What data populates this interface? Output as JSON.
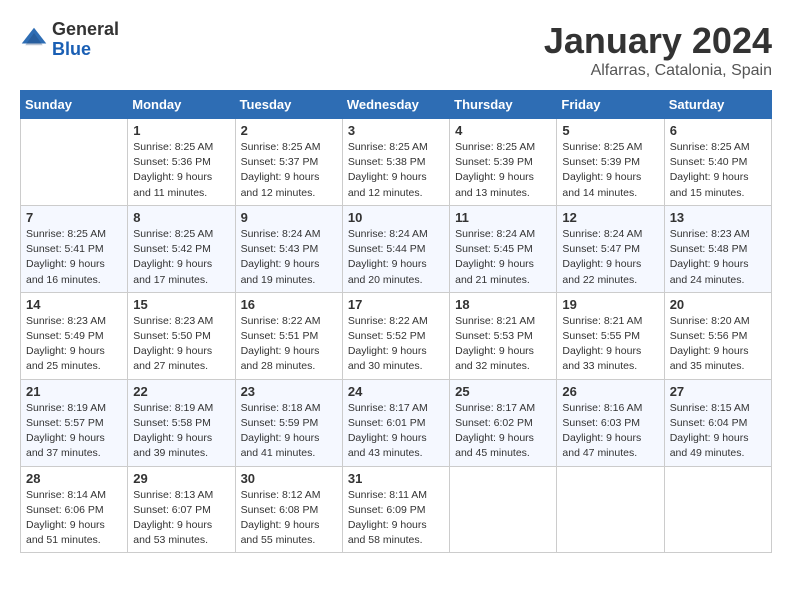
{
  "header": {
    "logo_general": "General",
    "logo_blue": "Blue",
    "month_title": "January 2024",
    "location": "Alfarras, Catalonia, Spain"
  },
  "weekdays": [
    "Sunday",
    "Monday",
    "Tuesday",
    "Wednesday",
    "Thursday",
    "Friday",
    "Saturday"
  ],
  "weeks": [
    [
      {
        "day": "",
        "sunrise": "",
        "sunset": "",
        "daylight": ""
      },
      {
        "day": "1",
        "sunrise": "Sunrise: 8:25 AM",
        "sunset": "Sunset: 5:36 PM",
        "daylight": "Daylight: 9 hours and 11 minutes."
      },
      {
        "day": "2",
        "sunrise": "Sunrise: 8:25 AM",
        "sunset": "Sunset: 5:37 PM",
        "daylight": "Daylight: 9 hours and 12 minutes."
      },
      {
        "day": "3",
        "sunrise": "Sunrise: 8:25 AM",
        "sunset": "Sunset: 5:38 PM",
        "daylight": "Daylight: 9 hours and 12 minutes."
      },
      {
        "day": "4",
        "sunrise": "Sunrise: 8:25 AM",
        "sunset": "Sunset: 5:39 PM",
        "daylight": "Daylight: 9 hours and 13 minutes."
      },
      {
        "day": "5",
        "sunrise": "Sunrise: 8:25 AM",
        "sunset": "Sunset: 5:39 PM",
        "daylight": "Daylight: 9 hours and 14 minutes."
      },
      {
        "day": "6",
        "sunrise": "Sunrise: 8:25 AM",
        "sunset": "Sunset: 5:40 PM",
        "daylight": "Daylight: 9 hours and 15 minutes."
      }
    ],
    [
      {
        "day": "7",
        "sunrise": "Sunrise: 8:25 AM",
        "sunset": "Sunset: 5:41 PM",
        "daylight": "Daylight: 9 hours and 16 minutes."
      },
      {
        "day": "8",
        "sunrise": "Sunrise: 8:25 AM",
        "sunset": "Sunset: 5:42 PM",
        "daylight": "Daylight: 9 hours and 17 minutes."
      },
      {
        "day": "9",
        "sunrise": "Sunrise: 8:24 AM",
        "sunset": "Sunset: 5:43 PM",
        "daylight": "Daylight: 9 hours and 19 minutes."
      },
      {
        "day": "10",
        "sunrise": "Sunrise: 8:24 AM",
        "sunset": "Sunset: 5:44 PM",
        "daylight": "Daylight: 9 hours and 20 minutes."
      },
      {
        "day": "11",
        "sunrise": "Sunrise: 8:24 AM",
        "sunset": "Sunset: 5:45 PM",
        "daylight": "Daylight: 9 hours and 21 minutes."
      },
      {
        "day": "12",
        "sunrise": "Sunrise: 8:24 AM",
        "sunset": "Sunset: 5:47 PM",
        "daylight": "Daylight: 9 hours and 22 minutes."
      },
      {
        "day": "13",
        "sunrise": "Sunrise: 8:23 AM",
        "sunset": "Sunset: 5:48 PM",
        "daylight": "Daylight: 9 hours and 24 minutes."
      }
    ],
    [
      {
        "day": "14",
        "sunrise": "Sunrise: 8:23 AM",
        "sunset": "Sunset: 5:49 PM",
        "daylight": "Daylight: 9 hours and 25 minutes."
      },
      {
        "day": "15",
        "sunrise": "Sunrise: 8:23 AM",
        "sunset": "Sunset: 5:50 PM",
        "daylight": "Daylight: 9 hours and 27 minutes."
      },
      {
        "day": "16",
        "sunrise": "Sunrise: 8:22 AM",
        "sunset": "Sunset: 5:51 PM",
        "daylight": "Daylight: 9 hours and 28 minutes."
      },
      {
        "day": "17",
        "sunrise": "Sunrise: 8:22 AM",
        "sunset": "Sunset: 5:52 PM",
        "daylight": "Daylight: 9 hours and 30 minutes."
      },
      {
        "day": "18",
        "sunrise": "Sunrise: 8:21 AM",
        "sunset": "Sunset: 5:53 PM",
        "daylight": "Daylight: 9 hours and 32 minutes."
      },
      {
        "day": "19",
        "sunrise": "Sunrise: 8:21 AM",
        "sunset": "Sunset: 5:55 PM",
        "daylight": "Daylight: 9 hours and 33 minutes."
      },
      {
        "day": "20",
        "sunrise": "Sunrise: 8:20 AM",
        "sunset": "Sunset: 5:56 PM",
        "daylight": "Daylight: 9 hours and 35 minutes."
      }
    ],
    [
      {
        "day": "21",
        "sunrise": "Sunrise: 8:19 AM",
        "sunset": "Sunset: 5:57 PM",
        "daylight": "Daylight: 9 hours and 37 minutes."
      },
      {
        "day": "22",
        "sunrise": "Sunrise: 8:19 AM",
        "sunset": "Sunset: 5:58 PM",
        "daylight": "Daylight: 9 hours and 39 minutes."
      },
      {
        "day": "23",
        "sunrise": "Sunrise: 8:18 AM",
        "sunset": "Sunset: 5:59 PM",
        "daylight": "Daylight: 9 hours and 41 minutes."
      },
      {
        "day": "24",
        "sunrise": "Sunrise: 8:17 AM",
        "sunset": "Sunset: 6:01 PM",
        "daylight": "Daylight: 9 hours and 43 minutes."
      },
      {
        "day": "25",
        "sunrise": "Sunrise: 8:17 AM",
        "sunset": "Sunset: 6:02 PM",
        "daylight": "Daylight: 9 hours and 45 minutes."
      },
      {
        "day": "26",
        "sunrise": "Sunrise: 8:16 AM",
        "sunset": "Sunset: 6:03 PM",
        "daylight": "Daylight: 9 hours and 47 minutes."
      },
      {
        "day": "27",
        "sunrise": "Sunrise: 8:15 AM",
        "sunset": "Sunset: 6:04 PM",
        "daylight": "Daylight: 9 hours and 49 minutes."
      }
    ],
    [
      {
        "day": "28",
        "sunrise": "Sunrise: 8:14 AM",
        "sunset": "Sunset: 6:06 PM",
        "daylight": "Daylight: 9 hours and 51 minutes."
      },
      {
        "day": "29",
        "sunrise": "Sunrise: 8:13 AM",
        "sunset": "Sunset: 6:07 PM",
        "daylight": "Daylight: 9 hours and 53 minutes."
      },
      {
        "day": "30",
        "sunrise": "Sunrise: 8:12 AM",
        "sunset": "Sunset: 6:08 PM",
        "daylight": "Daylight: 9 hours and 55 minutes."
      },
      {
        "day": "31",
        "sunrise": "Sunrise: 8:11 AM",
        "sunset": "Sunset: 6:09 PM",
        "daylight": "Daylight: 9 hours and 58 minutes."
      },
      {
        "day": "",
        "sunrise": "",
        "sunset": "",
        "daylight": ""
      },
      {
        "day": "",
        "sunrise": "",
        "sunset": "",
        "daylight": ""
      },
      {
        "day": "",
        "sunrise": "",
        "sunset": "",
        "daylight": ""
      }
    ]
  ]
}
